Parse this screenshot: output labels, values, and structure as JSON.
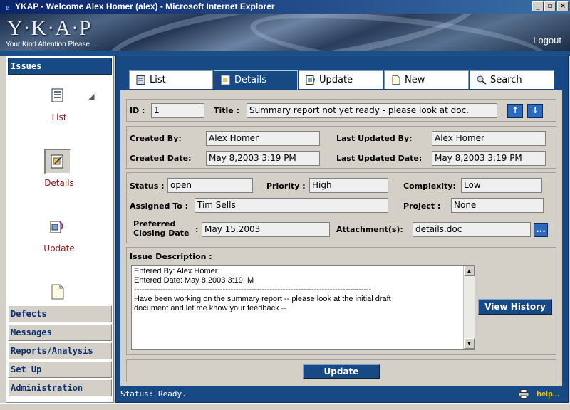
{
  "window": {
    "title": "YKAP - Welcome Alex Homer (alex) - Microsoft Internet Explorer",
    "ie_icon": "ie-icon",
    "minimize": "_",
    "maximize": "▫",
    "close": "×"
  },
  "banner": {
    "logo": "Y·K·A·P",
    "tagline": "Your Kind Attention Please ...",
    "logout": "Logout"
  },
  "nav": {
    "issues": "Issues",
    "items": [
      {
        "label": "List",
        "icon": "list-icon"
      },
      {
        "label": "Details",
        "icon": "details-icon"
      },
      {
        "label": "Update",
        "icon": "update-icon"
      },
      {
        "label": "",
        "icon": "new-document-icon"
      }
    ],
    "sections": [
      "Defects",
      "Messages",
      "Reports/Analysis",
      "Set Up",
      "Administration"
    ]
  },
  "tabs": [
    {
      "label": "List",
      "icon": "list-icon"
    },
    {
      "label": "Details",
      "icon": "details-icon",
      "active": true
    },
    {
      "label": "Update",
      "icon": "update-icon"
    },
    {
      "label": "New",
      "icon": "new-document-icon"
    },
    {
      "label": "Search",
      "icon": "search-icon"
    }
  ],
  "issue": {
    "id_label": "ID :",
    "id": "1",
    "title_label": "Title :",
    "title": "Summary report not yet ready - please look at doc.",
    "created_by_label": "Created By:",
    "created_by": "Alex Homer",
    "last_updated_by_label": "Last Updated By:",
    "last_updated_by": "Alex Homer",
    "created_date_label": "Created Date:",
    "created_date": "May 8,2003 3:19 PM",
    "last_updated_date_label": "Last Updated Date:",
    "last_updated_date": "May 8,2003 3:19 PM",
    "status_label": "Status :",
    "status": "open",
    "priority_label": "Priority :",
    "priority": "High",
    "complexity_label": "Complexity:",
    "complexity": "Low",
    "assigned_to_label": "Assigned To :",
    "assigned_to": "Tim Sells",
    "project_label": "Project :",
    "project": "None",
    "preferred_label_1": "Preferred",
    "preferred_label_2": "Closing Date",
    "preferred_colon": ":",
    "preferred_closing_date": "May 15,2003",
    "attachments_label": "Attachment(s):",
    "attachments": "details.doc",
    "browse": "...",
    "description_label": "Issue Description :",
    "description_lines": [
      "Entered By: Alex Homer",
      "Entered Date: May 8,2003 3:19: M",
      "-------------------------------------------------------------------------------------------",
      "Have been working on the summary report -- please look at the initial draft",
      "document and let me know your feedback --"
    ],
    "view_history": "View History",
    "update": "Update",
    "prev": "↑",
    "next": "↓"
  },
  "status": {
    "text": "Status:  Ready.",
    "help": "help..."
  }
}
